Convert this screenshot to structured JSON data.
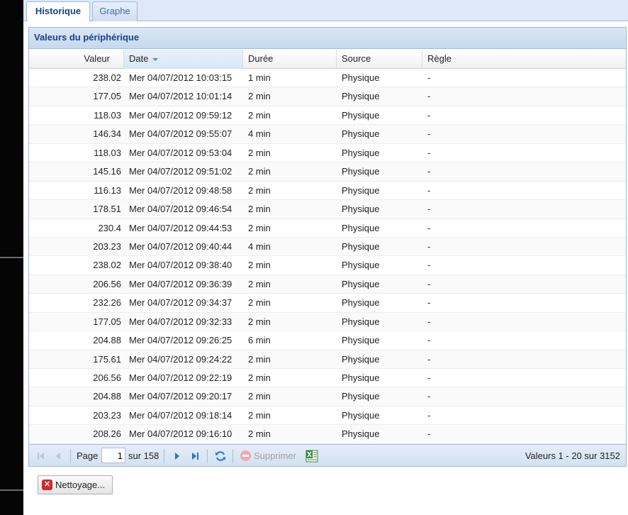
{
  "tabs": [
    {
      "label": "Historique",
      "active": true
    },
    {
      "label": "Graphe",
      "active": false
    }
  ],
  "panel": {
    "title": "Valeurs du périphérique"
  },
  "columns": {
    "valeur": "Valeur",
    "date": "Date",
    "duree": "Durée",
    "source": "Source",
    "regle": "Règle"
  },
  "rows": [
    {
      "valeur": "238.02",
      "date": "Mer 04/07/2012 10:03:15",
      "duree": "1 min",
      "source": "Physique",
      "regle": "-"
    },
    {
      "valeur": "177.05",
      "date": "Mer 04/07/2012 10:01:14",
      "duree": "2 min",
      "source": "Physique",
      "regle": "-"
    },
    {
      "valeur": "118.03",
      "date": "Mer 04/07/2012 09:59:12",
      "duree": "2 min",
      "source": "Physique",
      "regle": "-"
    },
    {
      "valeur": "146.34",
      "date": "Mer 04/07/2012 09:55:07",
      "duree": "4 min",
      "source": "Physique",
      "regle": "-"
    },
    {
      "valeur": "118.03",
      "date": "Mer 04/07/2012 09:53:04",
      "duree": "2 min",
      "source": "Physique",
      "regle": "-"
    },
    {
      "valeur": "145.16",
      "date": "Mer 04/07/2012 09:51:02",
      "duree": "2 min",
      "source": "Physique",
      "regle": "-"
    },
    {
      "valeur": "116.13",
      "date": "Mer 04/07/2012 09:48:58",
      "duree": "2 min",
      "source": "Physique",
      "regle": "-"
    },
    {
      "valeur": "178.51",
      "date": "Mer 04/07/2012 09:46:54",
      "duree": "2 min",
      "source": "Physique",
      "regle": "-"
    },
    {
      "valeur": "230.4",
      "date": "Mer 04/07/2012 09:44:53",
      "duree": "2 min",
      "source": "Physique",
      "regle": "-"
    },
    {
      "valeur": "203.23",
      "date": "Mer 04/07/2012 09:40:44",
      "duree": "4 min",
      "source": "Physique",
      "regle": "-"
    },
    {
      "valeur": "238.02",
      "date": "Mer 04/07/2012 09:38:40",
      "duree": "2 min",
      "source": "Physique",
      "regle": "-"
    },
    {
      "valeur": "206.56",
      "date": "Mer 04/07/2012 09:36:39",
      "duree": "2 min",
      "source": "Physique",
      "regle": "-"
    },
    {
      "valeur": "232.26",
      "date": "Mer 04/07/2012 09:34:37",
      "duree": "2 min",
      "source": "Physique",
      "regle": "-"
    },
    {
      "valeur": "177.05",
      "date": "Mer 04/07/2012 09:32:33",
      "duree": "2 min",
      "source": "Physique",
      "regle": "-"
    },
    {
      "valeur": "204.88",
      "date": "Mer 04/07/2012 09:26:25",
      "duree": "6 min",
      "source": "Physique",
      "regle": "-"
    },
    {
      "valeur": "175.61",
      "date": "Mer 04/07/2012 09:24:22",
      "duree": "2 min",
      "source": "Physique",
      "regle": "-"
    },
    {
      "valeur": "206.56",
      "date": "Mer 04/07/2012 09:22:19",
      "duree": "2 min",
      "source": "Physique",
      "regle": "-"
    },
    {
      "valeur": "204.88",
      "date": "Mer 04/07/2012 09:20:17",
      "duree": "2 min",
      "source": "Physique",
      "regle": "-"
    },
    {
      "valeur": "203.23",
      "date": "Mer 04/07/2012 09:18:14",
      "duree": "2 min",
      "source": "Physique",
      "regle": "-"
    },
    {
      "valeur": "208.26",
      "date": "Mer 04/07/2012 09:16:10",
      "duree": "2 min",
      "source": "Physique",
      "regle": "-"
    }
  ],
  "pager": {
    "page_label": "Page",
    "page_value": "1",
    "of_label": "sur 158",
    "delete_label": "Supprimer",
    "info": "Valeurs 1 - 20 sur 3152"
  },
  "cleanup": {
    "label": "Nettoyage..."
  },
  "icons": {
    "first": "first-page-icon",
    "prev": "prev-page-icon",
    "next": "next-page-icon",
    "last": "last-page-icon",
    "refresh": "refresh-icon",
    "delete": "delete-icon",
    "export": "excel-export-icon",
    "cleanup": "cleanup-icon"
  },
  "colors": {
    "accent": "#15428b",
    "border": "#99bbe8",
    "header_bg": "#c7d9ef"
  }
}
